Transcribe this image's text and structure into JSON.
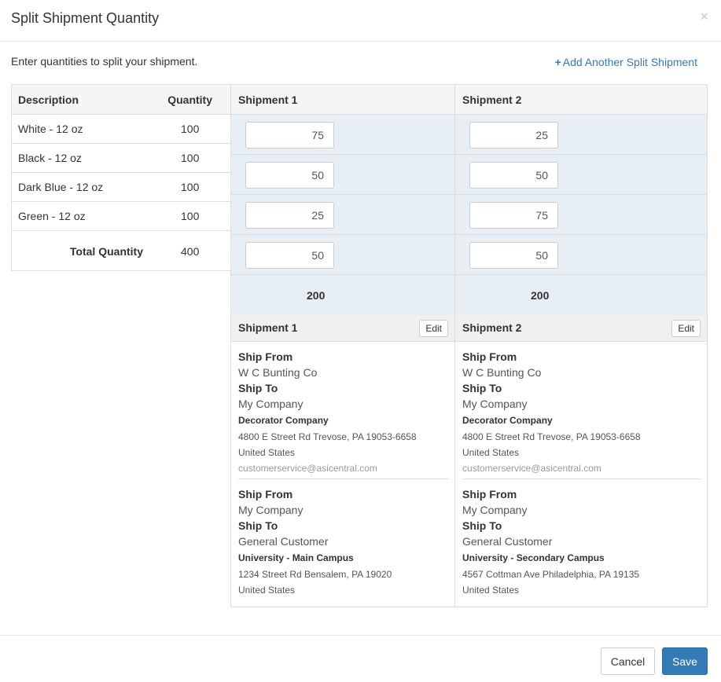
{
  "modal": {
    "title": "Split Shipment Quantity",
    "close_glyph": "×",
    "intro": "Enter quantities to split your shipment.",
    "add_link_icon": "+",
    "add_link_label": "Add Another Split Shipment"
  },
  "products": {
    "headers": {
      "description": "Description",
      "quantity": "Quantity"
    },
    "rows": [
      {
        "description": "White - 12 oz",
        "quantity": "100"
      },
      {
        "description": "Black - 12 oz",
        "quantity": "100"
      },
      {
        "description": "Dark Blue - 12 oz",
        "quantity": "100"
      },
      {
        "description": "Green - 12 oz",
        "quantity": "100"
      }
    ],
    "total_label": "Total Quantity",
    "total_value": "400"
  },
  "shipments": [
    {
      "name": "Shipment 1",
      "quantities": [
        "75",
        "50",
        "25",
        "50"
      ],
      "total": "200",
      "edit_label": "Edit",
      "addresses": [
        {
          "ship_from_label": "Ship From",
          "ship_from": "W C Bunting Co",
          "ship_to_label": "Ship To",
          "ship_to": "My Company",
          "company": "Decorator Company",
          "street": "4800 E Street Rd Trevose, PA 19053-6658",
          "country": "United States",
          "email": "customerservice@asicentral.com"
        },
        {
          "ship_from_label": "Ship From",
          "ship_from": "My Company",
          "ship_to_label": "Ship To",
          "ship_to": "General Customer",
          "company": "University - Main Campus",
          "street": "1234 Street Rd Bensalem, PA 19020",
          "country": "United States"
        }
      ]
    },
    {
      "name": "Shipment 2",
      "quantities": [
        "25",
        "50",
        "75",
        "50"
      ],
      "total": "200",
      "edit_label": "Edit",
      "addresses": [
        {
          "ship_from_label": "Ship From",
          "ship_from": "W C Bunting Co",
          "ship_to_label": "Ship To",
          "ship_to": "My Company",
          "company": "Decorator Company",
          "street": "4800 E Street Rd Trevose, PA 19053-6658",
          "country": "United States",
          "email": "customerservice@asicentral.com"
        },
        {
          "ship_from_label": "Ship From",
          "ship_from": "My Company",
          "ship_to_label": "Ship To",
          "ship_to": "General Customer",
          "company": "University - Secondary Campus",
          "street": "4567 Cottman Ave Philadelphia, PA 19135",
          "country": "United States"
        }
      ]
    }
  ],
  "footer": {
    "cancel_label": "Cancel",
    "save_label": "Save"
  },
  "colors": {
    "primary": "#337ab7",
    "quantity_area": "#e7eef4"
  }
}
